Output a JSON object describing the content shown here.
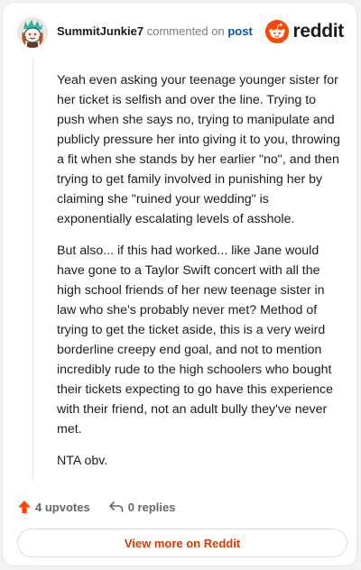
{
  "header": {
    "username": "SummitJunkie7",
    "action_text": "commented on",
    "post_link": "post",
    "brand_name": "reddit"
  },
  "comment": {
    "paragraphs": [
      "Yeah even asking your teenage younger sister for her ticket is selfish and over the line. Trying to push when she says no, trying to manipulate and publicly pressure her into giving it to you, throwing a fit when she stands by her earlier \"no\", and then trying to get family involved in punishing her by claiming she \"ruined your wedding\" is exponentially escalating levels of asshole.",
      "But also... if this had worked... like Jane would have gone to a Taylor Swift concert with all the high school friends of her new teenage sister in law who she's probably never met? Method of trying to get the ticket aside, this is a very weird borderline creepy end goal, and not to mention incredibly rude to the high schoolers who bought their tickets expecting to go have this experience with their friend, not an adult bully they've never met.",
      "NTA obv."
    ]
  },
  "actions": {
    "upvotes_label": "4 upvotes",
    "replies_label": "0 replies"
  },
  "footer": {
    "view_more_label": "View more on Reddit"
  },
  "colors": {
    "brand_orange": "#ff4500",
    "link_blue": "#0a4fb3",
    "cta_text": "#d93a00"
  },
  "icons": {
    "avatar": "snoo-avatar",
    "brand": "reddit-logo-icon",
    "upvote": "upvote-arrow-icon",
    "reply": "reply-arrow-icon"
  }
}
